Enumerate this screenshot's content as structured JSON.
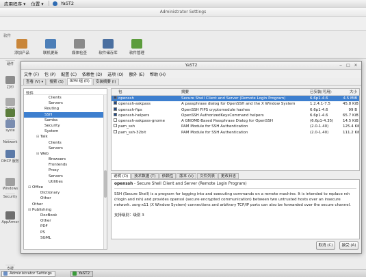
{
  "top_panel": {
    "menus": [
      "应用程序 ▾",
      "位置 ▾"
    ],
    "active_app": "YaST2"
  },
  "admin_window": {
    "title": "Administrator Settings",
    "group_software": "软件",
    "toolbar_items": [
      {
        "label": "添加产品",
        "color": "#c9863a"
      },
      {
        "label": "联机更新",
        "color": "#4d7fb8"
      },
      {
        "label": "媒体检查",
        "color": "#8a8a8a"
      },
      {
        "label": "软件储存库",
        "color": "#4a6fa0"
      },
      {
        "label": "软件管理",
        "color": "#5c9c3c"
      }
    ],
    "left_strip": [
      {
        "label": "硬件",
        "color": "#c8c8c8"
      },
      {
        "label": "打印",
        "color": "#8c8c8c"
      },
      {
        "label": "Syste",
        "color": "#ababab"
      },
      {
        "label": "Jabb",
        "color": "#5b7c3b"
      },
      {
        "label": "syste",
        "color": "#7a8db0"
      },
      {
        "label": "Network",
        "color": "#c8c8c8"
      },
      {
        "label": "DHCP 服务器",
        "color": "#5c7aa8"
      },
      {
        "label": "Windows",
        "color": "#a0a0a0"
      },
      {
        "label": "Security",
        "color": "#c8c8c8"
      },
      {
        "label": "AppArmor",
        "color": "#6e6e6e"
      },
      {
        "label": "支援",
        "color": "#c8c8c8"
      }
    ]
  },
  "taskbar": {
    "items": [
      {
        "label": "Administrator Settings",
        "active": false
      },
      {
        "label": "YaST2",
        "active": true
      }
    ]
  },
  "yast": {
    "title": "YaST2",
    "menu": [
      "文件 (F)",
      "包 (P)",
      "配置 (C)",
      "依赖性 (D)",
      "选项 (O)",
      "额外 (E)",
      "帮助 (H)"
    ],
    "view_tabs": [
      "查看 (V) ▾",
      "搜索 (S)",
      "RPM 组 (R)",
      "安装摘要 (I)"
    ],
    "active_view_tab": 2,
    "tree_header": "软件",
    "tree": [
      {
        "label": "Clients",
        "indent": 5,
        "toggle": ""
      },
      {
        "label": "Servers",
        "indent": 5,
        "toggle": ""
      },
      {
        "label": "Routing",
        "indent": 4,
        "toggle": ""
      },
      {
        "label": "SSH",
        "indent": 4,
        "toggle": "",
        "selected": true
      },
      {
        "label": "Samba",
        "indent": 4,
        "toggle": ""
      },
      {
        "label": "Security",
        "indent": 4,
        "toggle": ""
      },
      {
        "label": "System",
        "indent": 4,
        "toggle": ""
      },
      {
        "label": "Talk",
        "indent": 3,
        "toggle": "⊟"
      },
      {
        "label": "Clients",
        "indent": 5,
        "toggle": ""
      },
      {
        "label": "Servers",
        "indent": 5,
        "toggle": ""
      },
      {
        "label": "Web",
        "indent": 3,
        "toggle": "⊟"
      },
      {
        "label": "Browsers",
        "indent": 5,
        "toggle": ""
      },
      {
        "label": "Frontends",
        "indent": 5,
        "toggle": ""
      },
      {
        "label": "Proxy",
        "indent": 5,
        "toggle": ""
      },
      {
        "label": "Servers",
        "indent": 5,
        "toggle": ""
      },
      {
        "label": "Utilities",
        "indent": 5,
        "toggle": ""
      },
      {
        "label": "Office",
        "indent": 1,
        "toggle": "⊟"
      },
      {
        "label": "Dictionary",
        "indent": 3,
        "toggle": ""
      },
      {
        "label": "Other",
        "indent": 3,
        "toggle": ""
      },
      {
        "label": "Other",
        "indent": 1,
        "toggle": ""
      },
      {
        "label": "Publishing",
        "indent": 1,
        "toggle": "⊟"
      },
      {
        "label": "DocBook",
        "indent": 3,
        "toggle": ""
      },
      {
        "label": "Other",
        "indent": 3,
        "toggle": ""
      },
      {
        "label": "PDF",
        "indent": 3,
        "toggle": ""
      },
      {
        "label": "PS",
        "indent": 3,
        "toggle": ""
      },
      {
        "label": "SGML",
        "indent": 3,
        "toggle": ""
      }
    ],
    "table_headers": [
      "包",
      "摘要",
      "已安装(可用)",
      "大小"
    ],
    "packages": [
      {
        "checked": true,
        "name": "openssh",
        "summary": "Secure Shell Client and Server (Remote Login Program)",
        "version": "6.6p1-4.6",
        "size": "4.5 MiB",
        "selected": true
      },
      {
        "checked": true,
        "name": "openssh-askpass",
        "summary": "A passphrase dialog for OpenSSH and the X Window System",
        "version": "1.2.4.1-7.5",
        "size": "45.8 KiB",
        "selected": false
      },
      {
        "checked": true,
        "name": "openssh-fips",
        "summary": "OpenSSH FIPS cryptomodule hashes",
        "version": "6.6p1-4.6",
        "size": "99 B",
        "selected": false
      },
      {
        "checked": true,
        "name": "openssh-helpers",
        "summary": "OpenSSH AuthorizedKeysCommand helpers",
        "version": "6.6p1-4.6",
        "size": "65.7 KiB",
        "selected": false
      },
      {
        "checked": false,
        "name": "openssh-askpass-gnome",
        "summary": "A GNOME-Based Passphrase Dialog for OpenSSH",
        "version": "(6.6p1-4.35)",
        "size": "14.5 KiB",
        "selected": false
      },
      {
        "checked": false,
        "name": "pam_ssh",
        "summary": "PAM Module for SSH Authentication",
        "version": "(2.0-1.40)",
        "size": "125.4 KiB",
        "selected": false
      },
      {
        "checked": false,
        "name": "pam_ssh-32bit",
        "summary": "PAM Module for SSH Authentication",
        "version": "(2.0-1.40)",
        "size": "111.2 KiB",
        "selected": false
      }
    ],
    "detail_tabs": [
      "说明 (D)",
      "技术数据 (T)",
      "依赖性",
      "版本 (V)",
      "文件列表",
      "更改日志"
    ],
    "active_detail_tab": 0,
    "detail": {
      "name": "openssh",
      "summary": " - Secure Shell Client and Server (Remote Login Program)",
      "description": "SSH (Secure Shell) is a program for logging into and executing commands on a remote machine. It is intended to replace rsh (rlogin and rsh) and provides openssl (secure encrypted communication) between two untrusted hosts over an insecure network. xorg-x11 (X Window System) connections and arbitrary TCP/IP ports can also be forwarded over the secure channel.",
      "support": "支持级别：级别 3"
    },
    "cancel_label": "取消 (C)",
    "accept_label": "接受 (A)"
  }
}
